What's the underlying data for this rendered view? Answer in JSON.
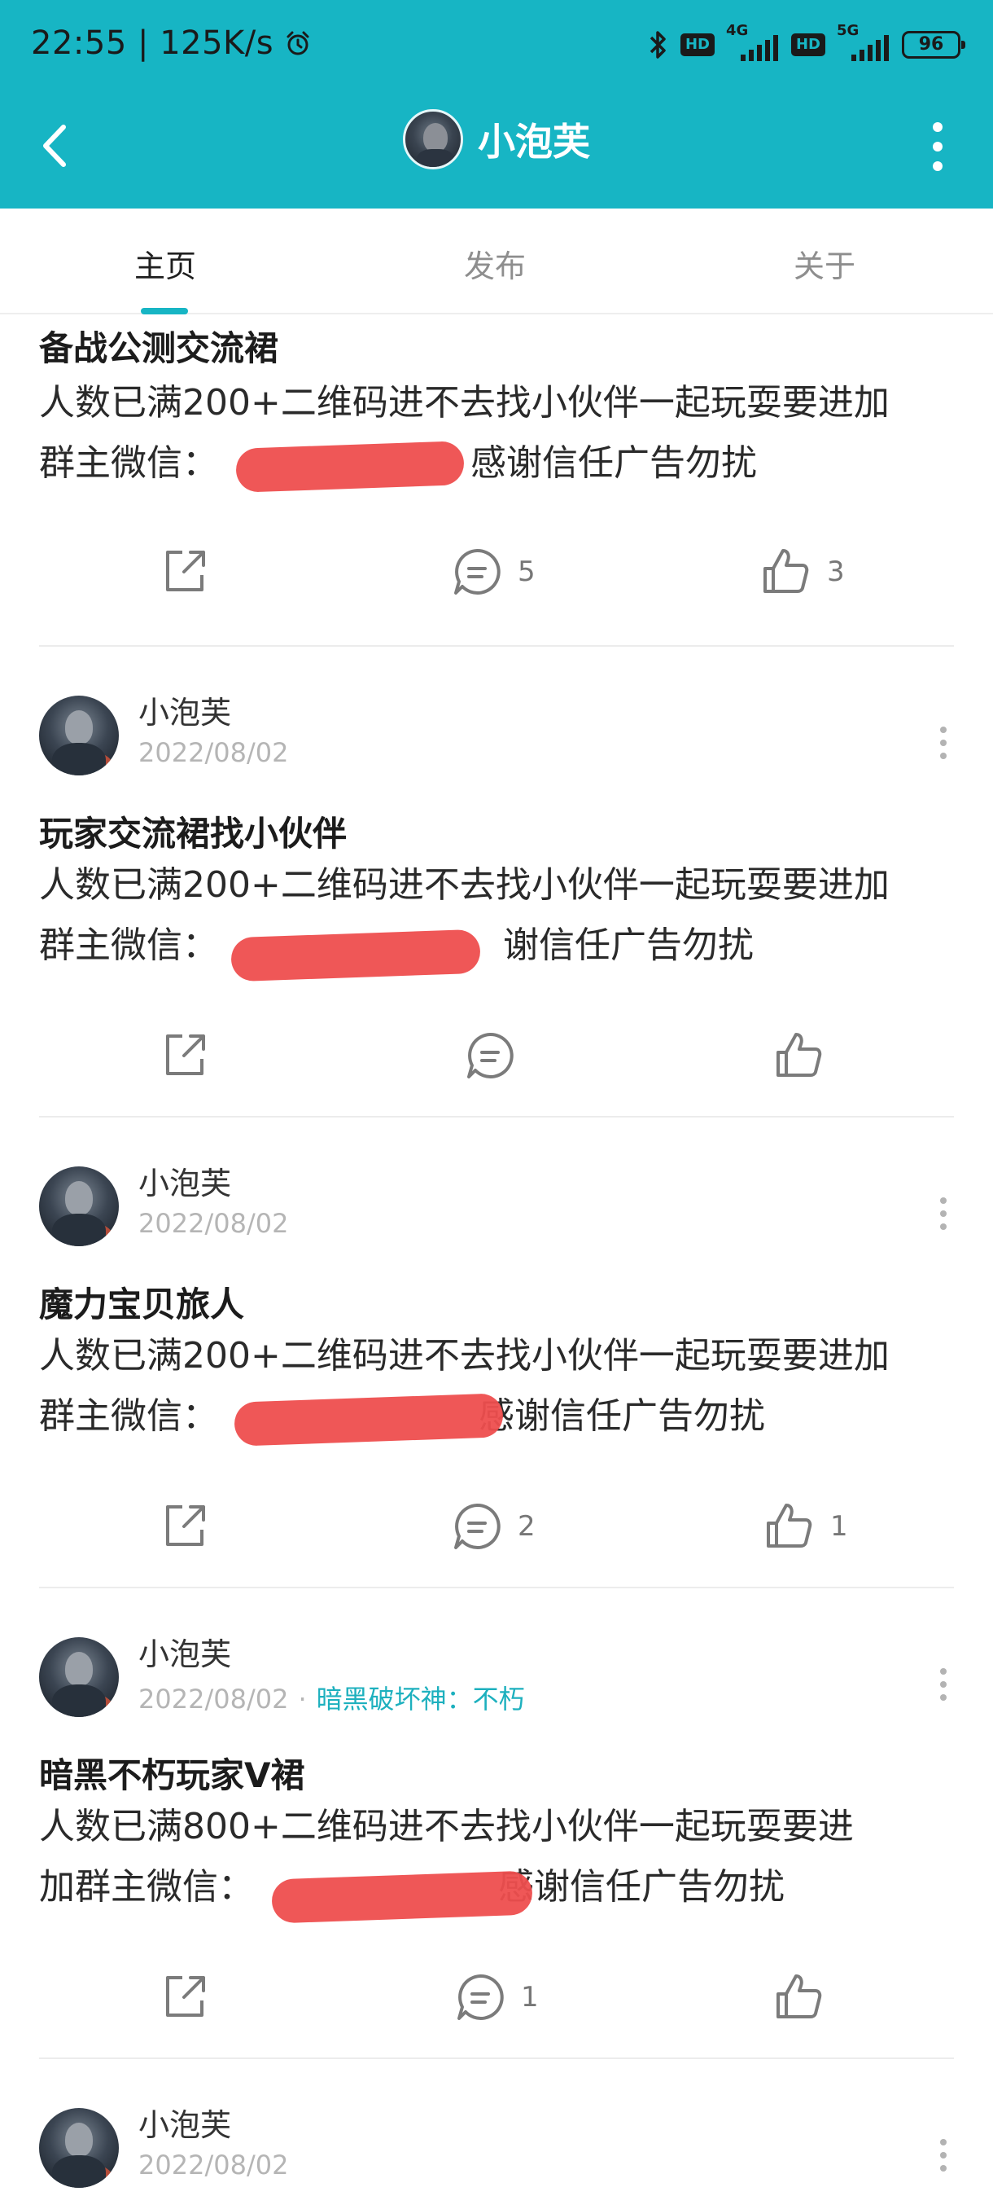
{
  "status_bar": {
    "time": "22:55",
    "speed": "125K/s",
    "net1": "4G",
    "net2": "5G",
    "hd": "HD",
    "battery": "96"
  },
  "appbar": {
    "title": "小泡芙",
    "background": "#17b5c4"
  },
  "tabs": [
    {
      "label": "主页",
      "active": true
    },
    {
      "label": "发布",
      "active": false
    },
    {
      "label": "关于",
      "active": false
    }
  ],
  "posts": [
    {
      "title": "备战公测交流裙",
      "body_line1": "人数已满200+二维码进不去找小伙伴一起玩耍要进加",
      "body_line2_prefix": "群主微信：",
      "body_line2_suffix": "感谢信任广告勿扰",
      "comments": "5",
      "likes": "3"
    },
    {
      "author": "小泡芙",
      "date": "2022/08/02",
      "title": "玩家交流裙找小伙伴",
      "body_line1": "人数已满200+二维码进不去找小伙伴一起玩耍要进加",
      "body_line2_prefix": "群主微信：",
      "body_line2_suffix": "谢信任广告勿扰",
      "comments": "",
      "likes": ""
    },
    {
      "author": "小泡芙",
      "date": "2022/08/02",
      "title": "魔力宝贝旅人",
      "body_line1": "人数已满200+二维码进不去找小伙伴一起玩耍要进加",
      "body_line2_prefix": "群主微信：",
      "body_line2_suffix": "感谢信任广告勿扰",
      "comments": "2",
      "likes": "1"
    },
    {
      "author": "小泡芙",
      "date": "2022/08/02",
      "tag": "暗黑破坏神：不朽",
      "title": "暗黑不朽玩家V裙",
      "body_line1": "人数已满800+二维码进不去找小伙伴一起玩耍要进",
      "body_line2_prefix": "加群主微信：",
      "body_line2_suffix": "感谢信任广告勿扰",
      "comments": "1",
      "likes": ""
    },
    {
      "author": "小泡芙",
      "date": "2022/08/02"
    }
  ],
  "icons": {
    "share": "share-icon",
    "comment": "comment-icon",
    "like": "thumbs-up-icon",
    "back": "back-arrow-icon",
    "menu": "more-vertical-icon"
  },
  "colors": {
    "accent": "#17b5c4",
    "redaction": "#ee4e4e"
  }
}
